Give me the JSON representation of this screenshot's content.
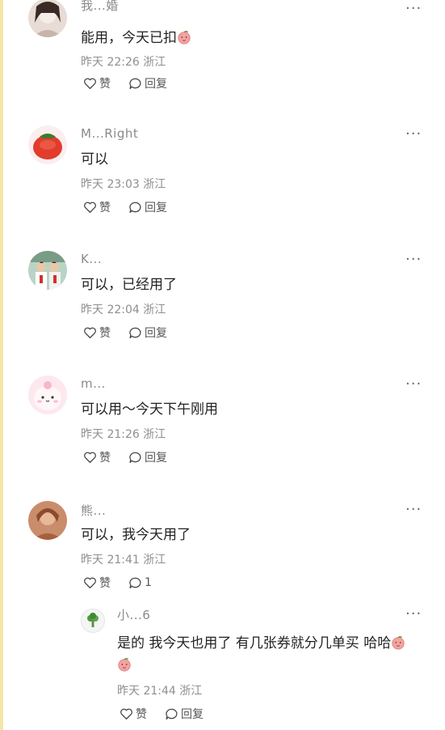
{
  "comments": [
    {
      "username": "我...婚",
      "text": "能用，今天已扣",
      "time": "昨天 22:26",
      "location": "浙江",
      "like_label": "赞",
      "reply_label": "回复"
    },
    {
      "username": "M...Right",
      "text": "可以",
      "time": "昨天 23:03",
      "location": "浙江",
      "like_label": "赞",
      "reply_label": "回复"
    },
    {
      "username": "K...",
      "text": "可以，已经用了",
      "time": "昨天 22:04",
      "location": "浙江",
      "like_label": "赞",
      "reply_label": "回复"
    },
    {
      "username": "m...",
      "text": "可以用～今天下午刚用",
      "time": "昨天 21:26",
      "location": "浙江",
      "like_label": "赞",
      "reply_label": "回复"
    },
    {
      "username": "熊...",
      "text": "可以，我今天用了",
      "time": "昨天 21:41",
      "location": "浙江",
      "like_label": "赞",
      "reply_count": "1"
    }
  ],
  "reply": {
    "username": "小...6",
    "text_line1": "是的 我今天也用了 有几张券就分几单买 哈哈",
    "time": "昨天 21:44",
    "location": "浙江",
    "like_label": "赞",
    "reply_label": "回复"
  },
  "more_label": "···",
  "icons": {
    "like": "heart-outline-icon",
    "reply": "speech-bubble-icon",
    "more": "more-dots-icon",
    "emoji": "peach-emoji-icon"
  }
}
